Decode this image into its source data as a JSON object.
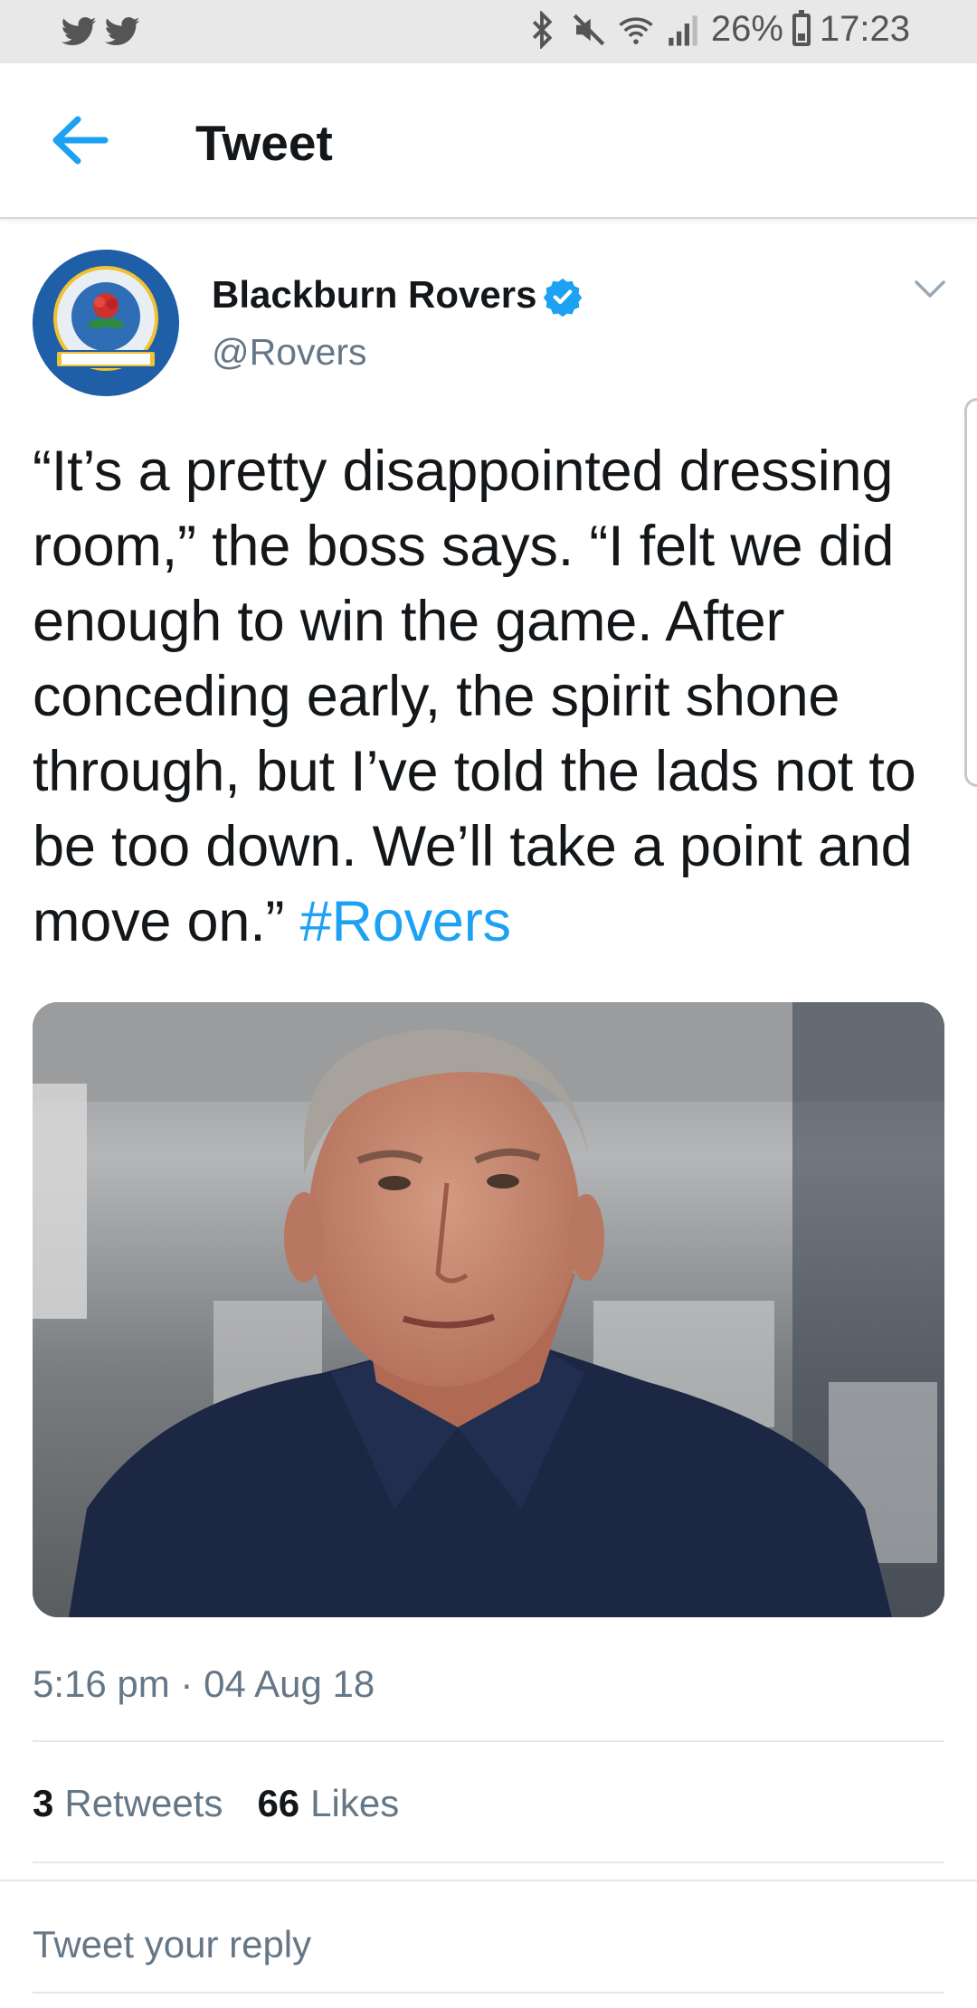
{
  "status_bar": {
    "battery": "26%",
    "time": "17:23"
  },
  "header": {
    "title": "Tweet"
  },
  "tweet": {
    "author_name": "Blackburn Rovers",
    "handle": "@Rovers",
    "text": "“It’s a pretty disappointed dressing room,” the boss says. “I felt we did enough to win the game. After conceding early, the spirit shone through, but I’ve told the lads not to be too down. We’ll take a point and move on.” ",
    "hashtag": "#Rovers",
    "timestamp": "5:16 pm · 04 Aug 18",
    "retweets_count": "3",
    "retweets_label": "Retweets",
    "likes_count": "66",
    "likes_label": "Likes"
  },
  "reply": {
    "placeholder": "Tweet your reply"
  },
  "colors": {
    "accent": "#1da1f2",
    "secondary_text": "#657786",
    "primary_text": "#14171a"
  }
}
